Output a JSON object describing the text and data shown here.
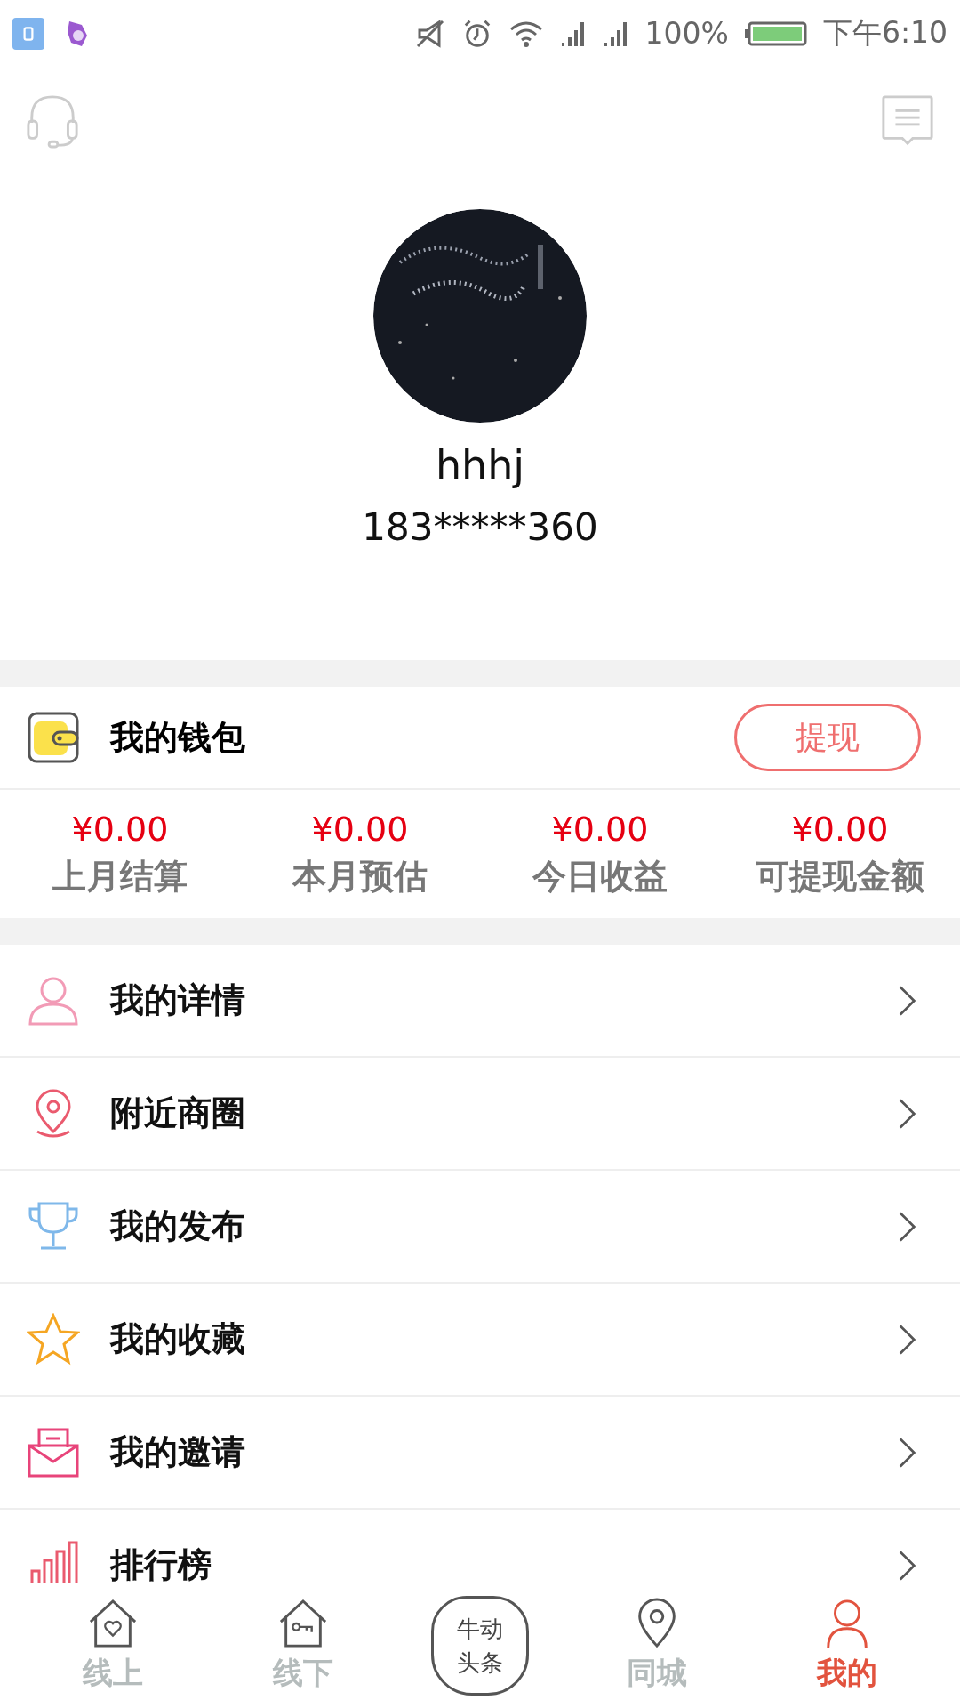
{
  "status_bar": {
    "battery": "100%",
    "time": "下午6:10"
  },
  "profile": {
    "name": "hhhj",
    "phone": "183*****360"
  },
  "wallet": {
    "title": "我的钱包",
    "button": "提现",
    "stats": [
      {
        "amount": "¥0.00",
        "label": "上月结算"
      },
      {
        "amount": "¥0.00",
        "label": "本月预估"
      },
      {
        "amount": "¥0.00",
        "label": "今日收益"
      },
      {
        "amount": "¥0.00",
        "label": "可提现金额"
      }
    ]
  },
  "menu": [
    {
      "label": "我的详情"
    },
    {
      "label": "附近商圈"
    },
    {
      "label": "我的发布"
    },
    {
      "label": "我的收藏"
    },
    {
      "label": "我的邀请"
    },
    {
      "label": "排行榜"
    }
  ],
  "nav": [
    {
      "label": "线上",
      "kind": "tab",
      "selected": false
    },
    {
      "label": "线下",
      "kind": "tab",
      "selected": false
    },
    {
      "label": "牛动头条",
      "kind": "center",
      "selected": false
    },
    {
      "label": "同城",
      "kind": "tab",
      "selected": false
    },
    {
      "label": "我的",
      "kind": "tab",
      "selected": true
    }
  ]
}
